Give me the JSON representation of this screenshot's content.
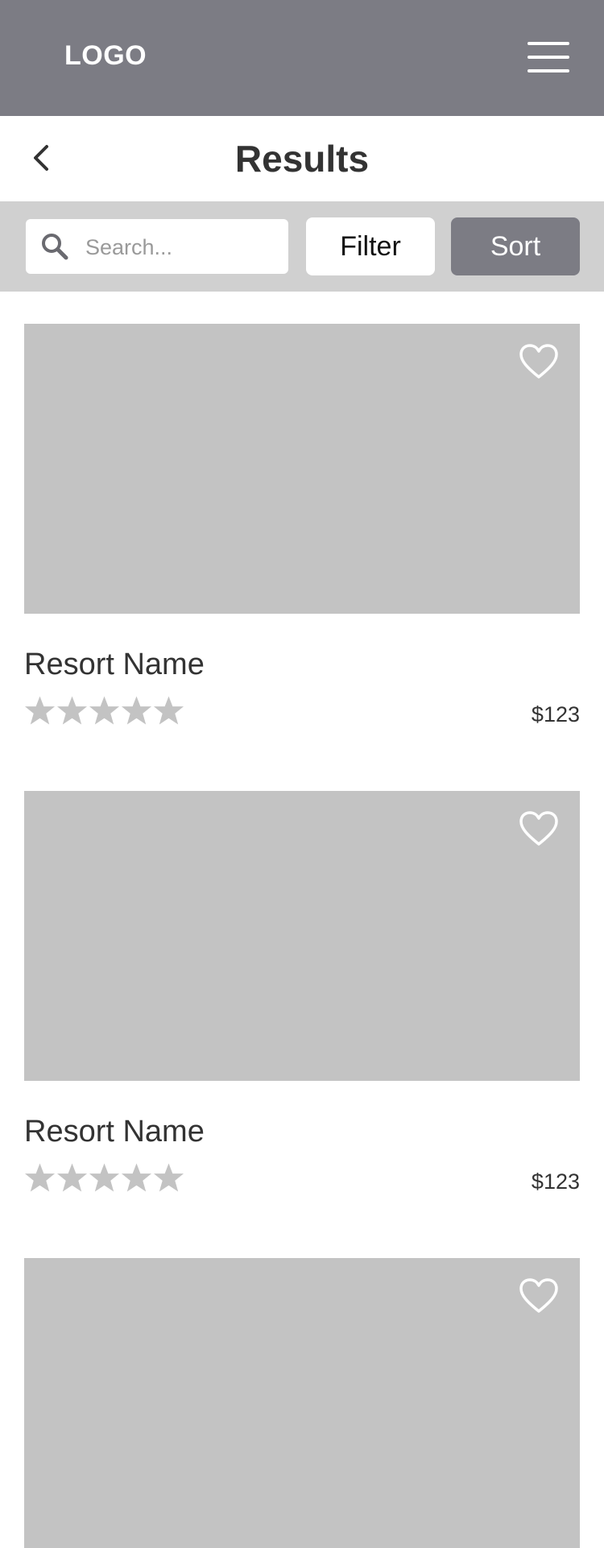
{
  "header": {
    "logo": "LOGO",
    "menu_icon": "hamburger-menu-icon"
  },
  "titlebar": {
    "back_icon": "chevron-left-icon",
    "title": "Results"
  },
  "toolbar": {
    "search_placeholder": "Search...",
    "search_value": "",
    "search_icon": "search-icon",
    "filter_label": "Filter",
    "sort_label": "Sort"
  },
  "results": [
    {
      "name": "Resort Name",
      "price": "$123",
      "rating": 0,
      "rating_max": 5,
      "favorite": false
    },
    {
      "name": "Resort Name",
      "price": "$123",
      "rating": 0,
      "rating_max": 5,
      "favorite": false
    },
    {
      "name": "",
      "price": "",
      "rating": 0,
      "rating_max": 5,
      "favorite": false
    }
  ],
  "colors": {
    "header_bg": "#7c7c84",
    "toolbar_bg": "#d0d0d0",
    "image_placeholder": "#c3c3c3",
    "star_empty": "#c3c3c3",
    "text": "#333333"
  }
}
